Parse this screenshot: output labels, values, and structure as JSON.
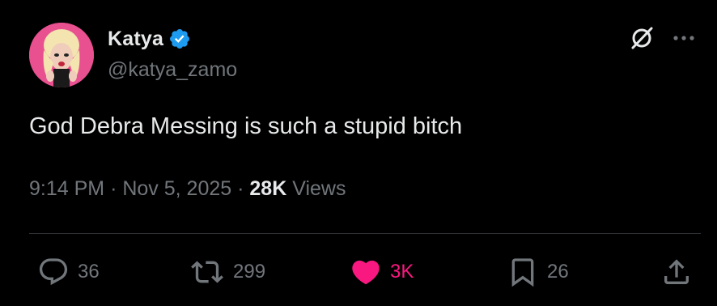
{
  "user": {
    "display_name": "Katya",
    "handle": "@katya_zamo",
    "verified": true
  },
  "tweet": {
    "text": "God Debra Messing is such a stupid bitch",
    "time": "9:14 PM",
    "separator": "·",
    "date": "Nov 5, 2025",
    "views_count": "28K",
    "views_label": "Views"
  },
  "actions": {
    "replies": "36",
    "retweets": "299",
    "likes": "3K",
    "bookmarks": "26"
  },
  "colors": {
    "background": "#000000",
    "text_primary": "#e7e9ea",
    "text_secondary": "#71767b",
    "verified_blue": "#1d9bf0",
    "like_pink": "#f91880",
    "divider": "#2f3336"
  },
  "icons": {
    "grok": "grok-icon",
    "more": "more-icon",
    "reply": "reply-icon",
    "retweet": "retweet-icon",
    "like": "heart-icon",
    "bookmark": "bookmark-icon",
    "share": "share-icon",
    "verified": "verified-badge-icon"
  }
}
